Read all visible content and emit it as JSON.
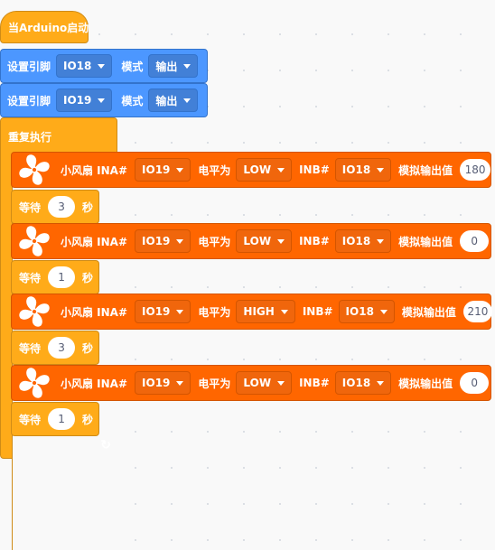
{
  "hat": {
    "label": "当Arduino启动"
  },
  "set_pins": [
    {
      "label": "设置引脚",
      "pin": "IO18",
      "mode_label": "模式",
      "mode": "输出"
    },
    {
      "label": "设置引脚",
      "pin": "IO19",
      "mode_label": "模式",
      "mode": "输出"
    }
  ],
  "loop": {
    "label": "重复执行",
    "end_icon": "loop-arrow-icon",
    "end_glyph": "↻"
  },
  "fan_blocks": [
    {
      "label": "小风扇 INA#",
      "ina_pin": "IO19",
      "level_label": "电平为",
      "level": "LOW",
      "inb_label": "INB#",
      "inb_pin": "IO18",
      "analog_label": "模拟输出值",
      "analog_value": "180"
    },
    {
      "label": "小风扇 INA#",
      "ina_pin": "IO19",
      "level_label": "电平为",
      "level": "LOW",
      "inb_label": "INB#",
      "inb_pin": "IO18",
      "analog_label": "模拟输出值",
      "analog_value": "0"
    },
    {
      "label": "小风扇 INA#",
      "ina_pin": "IO19",
      "level_label": "电平为",
      "level": "HIGH",
      "inb_label": "INB#",
      "inb_pin": "IO18",
      "analog_label": "模拟输出值",
      "analog_value": "210"
    },
    {
      "label": "小风扇 INA#",
      "ina_pin": "IO19",
      "level_label": "电平为",
      "level": "LOW",
      "inb_label": "INB#",
      "inb_pin": "IO18",
      "analog_label": "模拟输出值",
      "analog_value": "0"
    }
  ],
  "waits": [
    {
      "label": "等待",
      "value": "3",
      "unit": "秒"
    },
    {
      "label": "等待",
      "value": "1",
      "unit": "秒"
    },
    {
      "label": "等待",
      "value": "3",
      "unit": "秒"
    },
    {
      "label": "等待",
      "value": "1",
      "unit": "秒"
    }
  ],
  "colors": {
    "events": "#ffab19",
    "pins": "#4c97ff",
    "fan": "#ff6600",
    "canvas": "#f9f9f9"
  }
}
